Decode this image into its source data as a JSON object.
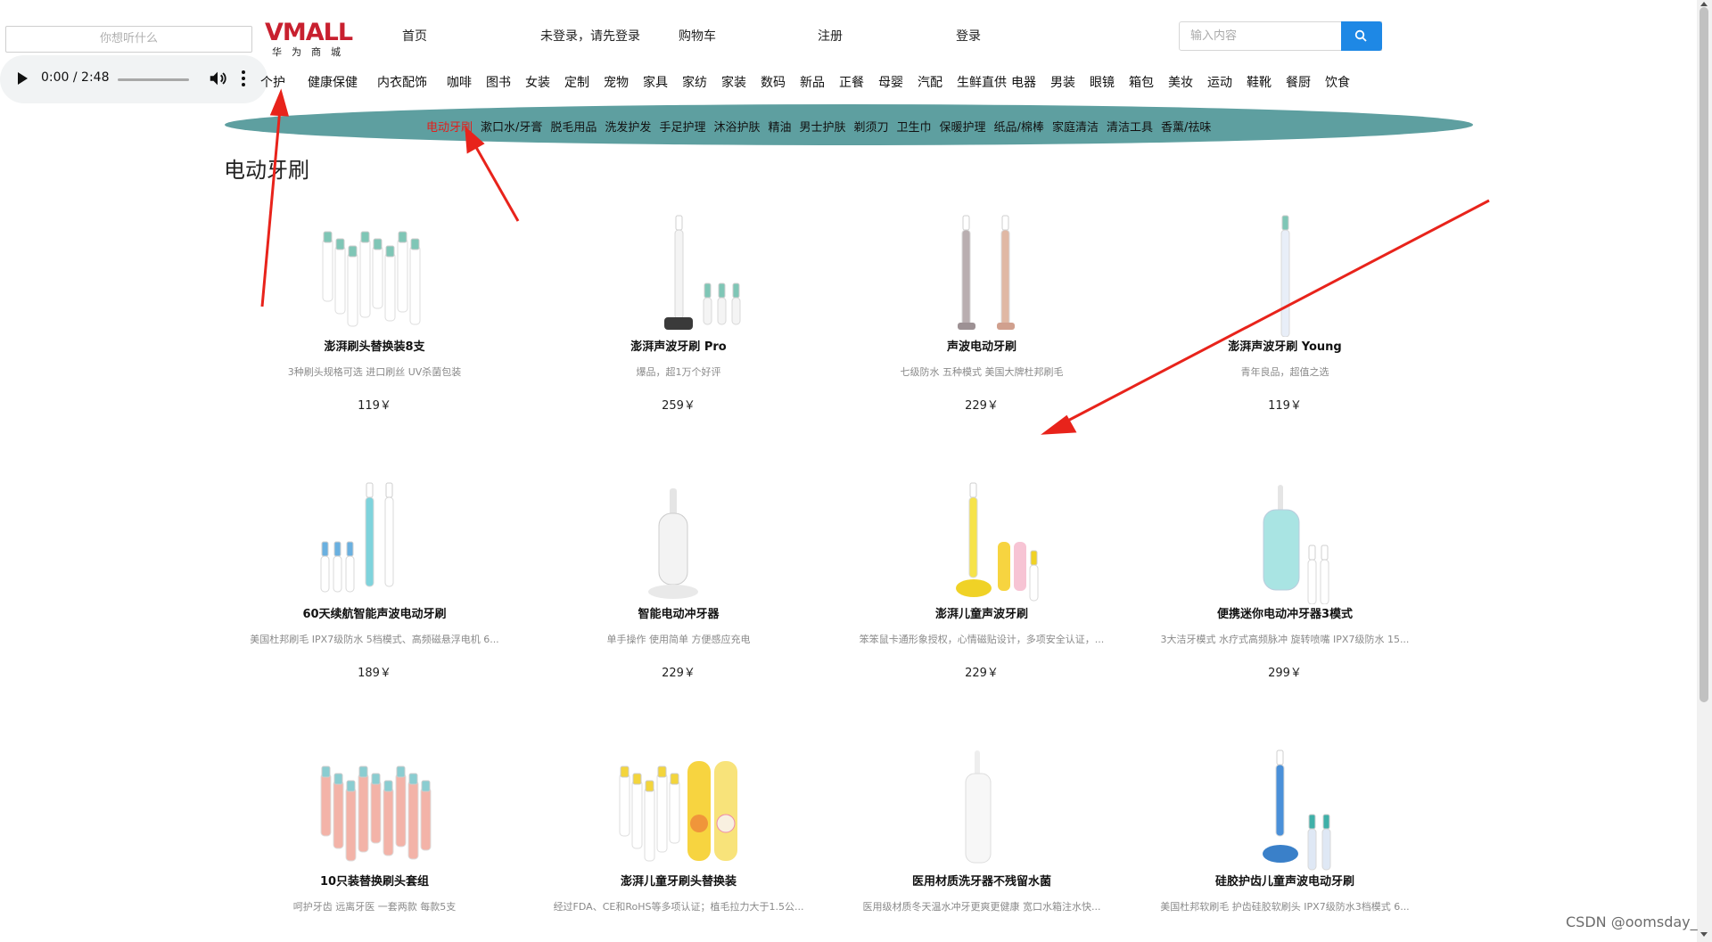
{
  "voice_input": {
    "placeholder": "你想听什么"
  },
  "audio_player": {
    "time": "0:00 / 2:48"
  },
  "header": {
    "logo_text": "VMALL",
    "logo_sub": "华为商城",
    "nav": [
      "首页",
      "未登录，请先登录",
      "购物车",
      "注册",
      "登录"
    ],
    "search_placeholder": "输入内容"
  },
  "categories": [
    "个护",
    "健康保健",
    "内衣配饰",
    "咖啡",
    "图书",
    "女装",
    "定制",
    "宠物",
    "家具",
    "家纺",
    "家装",
    "数码",
    "新品",
    "正餐",
    "母婴",
    "汽配",
    "生鲜直供",
    "电器",
    "男装",
    "眼镜",
    "箱包",
    "美妆",
    "运动",
    "鞋靴",
    "餐厨",
    "饮食"
  ],
  "subcategories": [
    "电动牙刷",
    "漱口水/牙膏",
    "脱毛用品",
    "洗发护发",
    "手足护理",
    "沐浴护肤",
    "精油",
    "男士护肤",
    "剃须刀",
    "卫生巾",
    "保暖护理",
    "纸品/棉棒",
    "家庭清洁",
    "清洁工具",
    "香薰/祛味"
  ],
  "active_subcategory": "电动牙刷",
  "section_title": "电动牙刷",
  "products": [
    {
      "name": "澎湃刷头替换装8支",
      "desc": "3种刷头规格可选 进口刷丝 UV杀菌包装",
      "price": "119￥",
      "icon": "brush-heads-set"
    },
    {
      "name": "澎湃声波牙刷 Pro",
      "desc": "爆品，超1万个好评",
      "price": "259￥",
      "icon": "toothbrush-pro"
    },
    {
      "name": "声波电动牙刷",
      "desc": "七级防水 五种模式 美国大牌杜邦刷毛",
      "price": "229￥",
      "icon": "sonic-toothbrush-pair"
    },
    {
      "name": "澎湃声波牙刷 Young",
      "desc": "青年良品，超值之选",
      "price": "119￥",
      "icon": "toothbrush-young"
    },
    {
      "name": "60天续航智能声波电动牙刷",
      "desc": "美国杜邦刷毛 IPX7级防水 5档模式、高频磁悬浮电机 6...",
      "price": "189￥",
      "icon": "smart-sonic-toothbrush"
    },
    {
      "name": "智能电动冲牙器",
      "desc": "单手操作 使用简单 方便感应充电",
      "price": "229￥",
      "icon": "water-flosser"
    },
    {
      "name": "澎湃儿童声波牙刷",
      "desc": "笨笨鼠卡通形象授权，心情磁贴设计，多项安全认证，...",
      "price": "229￥",
      "icon": "kids-toothbrush"
    },
    {
      "name": "便携迷你电动冲牙器3模式",
      "desc": "3大洁牙模式 水疗式高频脉冲 旋转喷嘴 IPX7级防水 15...",
      "price": "299￥",
      "icon": "portable-flosser"
    },
    {
      "name": "10只装替换刷头套组",
      "desc": "呵护牙齿 远离牙医 一套两款 每款5支",
      "price": "",
      "icon": "brush-heads-10"
    },
    {
      "name": "澎湃儿童牙刷头替换装",
      "desc": "经过FDA、CE和RoHS等多项认证；植毛拉力大于1.5公...",
      "price": "",
      "icon": "kids-brush-heads"
    },
    {
      "name": "医用材质洗牙器不残留水菌",
      "desc": "医用级材质冬天温水冲牙更爽更健康 宽口水箱注水快...",
      "price": "",
      "icon": "medical-flosser"
    },
    {
      "name": "硅胶护齿儿童声波电动牙刷",
      "desc": "美国杜邦软刷毛 护齿硅胶软刷头 IPX7级防水3档模式 6...",
      "price": "",
      "icon": "silicone-kids-toothbrush"
    }
  ],
  "watermark": "CSDN @oomsday_",
  "colors": {
    "brand_red": "#c8202f",
    "active_red": "#e0201d",
    "teal_bar": "#5e9fa0",
    "search_blue": "#1e88e5",
    "arrow_red": "#e8231b"
  }
}
